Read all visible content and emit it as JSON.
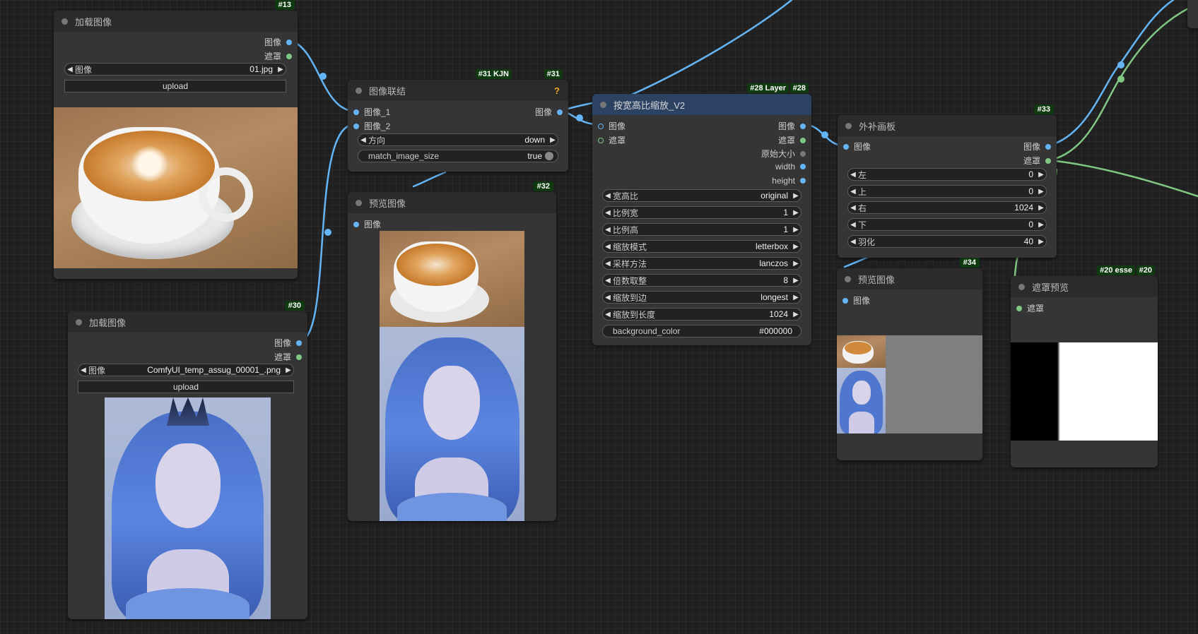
{
  "nodes": {
    "n13": {
      "badge": "#13",
      "title": "加载图像",
      "out_image": "图像",
      "out_mask": "遮罩",
      "image_label": "图像",
      "image_value": "01.jpg",
      "upload": "upload"
    },
    "n30": {
      "badge": "#30",
      "title": "加载图像",
      "out_image": "图像",
      "out_mask": "遮罩",
      "image_label": "图像",
      "image_value": "ComfyUI_temp_assug_00001_.png",
      "upload": "upload"
    },
    "n31": {
      "badge_a": "#31 KJN",
      "badge_b": "#31",
      "title": "图像联结",
      "help": "?",
      "in1": "图像_1",
      "in2": "图像_2",
      "out": "图像",
      "dir_label": "方向",
      "dir_value": "down",
      "match_label": "match_image_size",
      "match_value": "true"
    },
    "n32": {
      "badge": "#32",
      "title": "预览图像",
      "in": "图像"
    },
    "n28": {
      "badge_a": "#28 Layer",
      "badge_b": "#28",
      "title": "按宽高比缩放_V2",
      "in_image": "图像",
      "in_mask": "遮罩",
      "outs": [
        "图像",
        "遮罩",
        "原始大小",
        "width",
        "height"
      ],
      "widgets": [
        {
          "label": "宽高比",
          "value": "original"
        },
        {
          "label": "比例宽",
          "value": "1"
        },
        {
          "label": "比例高",
          "value": "1"
        },
        {
          "label": "缩放模式",
          "value": "letterbox"
        },
        {
          "label": "采样方法",
          "value": "lanczos"
        },
        {
          "label": "倍数取整",
          "value": "8"
        },
        {
          "label": "缩放到边",
          "value": "longest"
        },
        {
          "label": "缩放到长度",
          "value": "1024"
        }
      ],
      "bg_label": "background_color",
      "bg_value": "#000000"
    },
    "n33": {
      "badge": "#33",
      "title": "外补画板",
      "in": "图像",
      "out_image": "图像",
      "out_mask": "遮罩",
      "widgets": [
        {
          "label": "左",
          "value": "0"
        },
        {
          "label": "上",
          "value": "0"
        },
        {
          "label": "右",
          "value": "1024"
        },
        {
          "label": "下",
          "value": "0"
        },
        {
          "label": "羽化",
          "value": "40"
        }
      ]
    },
    "n34": {
      "badge": "#34",
      "title": "预览图像",
      "in": "图像"
    },
    "n20": {
      "badge_a": "#20 esse",
      "badge_b": "#20",
      "title": "遮罩预览",
      "in": "遮罩"
    }
  },
  "colors": {
    "image_wire": "#64b5f6",
    "mask_wire": "#81c784",
    "badge_bg": "#0f3a10",
    "node_bg": "#353535",
    "canvas_bg": "#202020"
  }
}
